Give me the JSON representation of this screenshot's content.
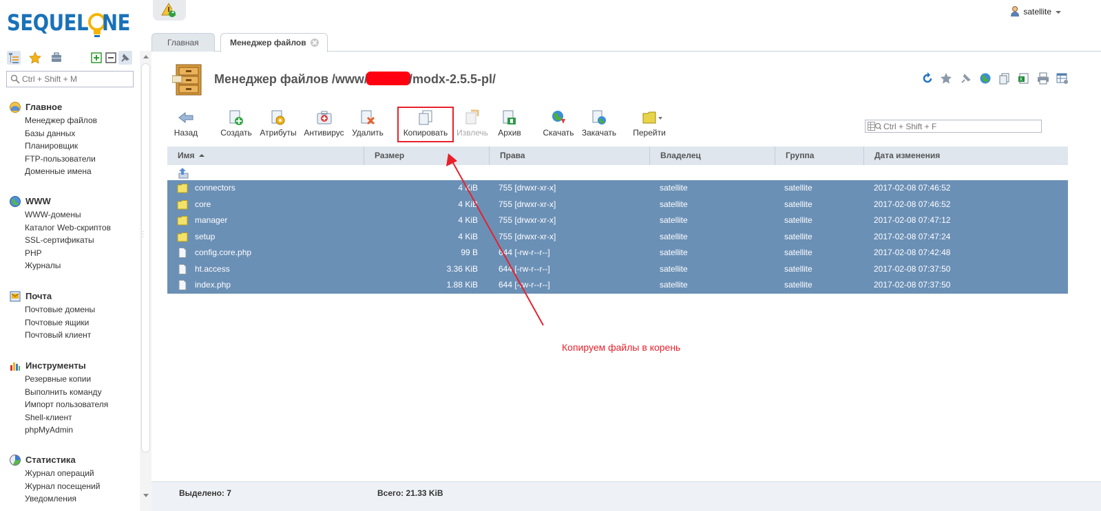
{
  "logo": {
    "part1": "SEQUEL",
    "part2": "NE"
  },
  "sidebar": {
    "search_placeholder": "Ctrl + Shift + M",
    "groups": [
      {
        "title": "Главное",
        "icon": "home-icon",
        "items": [
          "Менеджер файлов",
          "Базы данных",
          "Планировщик",
          "FTP-пользователи",
          "Доменные имена"
        ]
      },
      {
        "title": "WWW",
        "icon": "globe-icon",
        "items": [
          "WWW-домены",
          "Каталог Web-скриптов",
          "SSL-сертификаты",
          "PHP",
          "Журналы"
        ]
      },
      {
        "title": "Почта",
        "icon": "mail-icon",
        "items": [
          "Почтовые домены",
          "Почтовые ящики",
          "Почтовый клиент"
        ]
      },
      {
        "title": "Инструменты",
        "icon": "tools-icon",
        "items": [
          "Резервные копии",
          "Выполнить команду",
          "Импорт пользователя",
          "Shell-клиент",
          "phpMyAdmin"
        ]
      },
      {
        "title": "Статистика",
        "icon": "stats-icon",
        "items": [
          "Журнал операций",
          "Журнал посещений",
          "Уведомления"
        ]
      }
    ]
  },
  "notify": {
    "count": "1"
  },
  "user": {
    "name": "satellite"
  },
  "tabs": [
    {
      "label": "Главная"
    },
    {
      "label": "Менеджер файлов"
    }
  ],
  "page": {
    "title_prefix": "Менеджер файлов /www/",
    "title_suffix": "/modx-2.5.5-pl/"
  },
  "toolbar": {
    "back": "Назад",
    "create": "Создать",
    "attributes": "Атрибуты",
    "antivirus": "Антивирус",
    "delete": "Удалить",
    "copy": "Копировать",
    "extract": "Извлечь",
    "archive": "Архив",
    "download": "Скачать",
    "upload": "Закачать",
    "goto": "Перейти"
  },
  "grid_search_placeholder": "Ctrl + Shift + F",
  "grid": {
    "columns": [
      "Имя",
      "Размер",
      "Права",
      "Владелец",
      "Группа",
      "Дата изменения"
    ],
    "rows": [
      {
        "type": "folder",
        "name": "connectors",
        "size": "4 KiB",
        "perm": "755 [drwxr-xr-x]",
        "owner": "satellite",
        "group": "satellite",
        "date": "2017-02-08 07:46:52"
      },
      {
        "type": "folder",
        "name": "core",
        "size": "4 KiB",
        "perm": "755 [drwxr-xr-x]",
        "owner": "satellite",
        "group": "satellite",
        "date": "2017-02-08 07:46:52"
      },
      {
        "type": "folder",
        "name": "manager",
        "size": "4 KiB",
        "perm": "755 [drwxr-xr-x]",
        "owner": "satellite",
        "group": "satellite",
        "date": "2017-02-08 07:47:12"
      },
      {
        "type": "folder",
        "name": "setup",
        "size": "4 KiB",
        "perm": "755 [drwxr-xr-x]",
        "owner": "satellite",
        "group": "satellite",
        "date": "2017-02-08 07:47:24"
      },
      {
        "type": "file",
        "name": "config.core.php",
        "size": "99 B",
        "perm": "644 [-rw-r--r--]",
        "owner": "satellite",
        "group": "satellite",
        "date": "2017-02-08 07:42:48"
      },
      {
        "type": "file",
        "name": "ht.access",
        "size": "3.36 KiB",
        "perm": "644 [-rw-r--r--]",
        "owner": "satellite",
        "group": "satellite",
        "date": "2017-02-08 07:37:50"
      },
      {
        "type": "file",
        "name": "index.php",
        "size": "1.88 KiB",
        "perm": "644 [-rw-r--r--]",
        "owner": "satellite",
        "group": "satellite",
        "date": "2017-02-08 07:37:50"
      }
    ]
  },
  "annotation": {
    "text": "Копируем файлы в корень",
    "color": "#e8202a"
  },
  "footer": {
    "selected": "Выделено: 7",
    "total": "Всего: 21.33 KiB"
  },
  "colors": {
    "brand": "#1a71b8",
    "selection": "#6b90b6",
    "header": "#dfe6ee"
  }
}
